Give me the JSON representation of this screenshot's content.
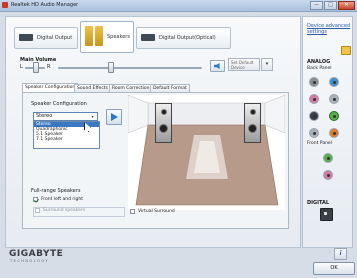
{
  "window": {
    "title": "Realtek HD Audio Manager",
    "minimize": "—",
    "maximize": "□",
    "close": "✕"
  },
  "device_tabs": [
    {
      "label": "Digital Output",
      "active": false
    },
    {
      "label": "Speakers",
      "active": true
    },
    {
      "label": "Digital Output(Optical)",
      "active": false
    }
  ],
  "main_volume": {
    "title": "Main Volume",
    "left": "L",
    "right": "R",
    "balance": 0.5,
    "level": 0.35,
    "set_default": "Set Default Device"
  },
  "sub_tabs": [
    "Speaker Configuration",
    "Sound Effects",
    "Room Correction",
    "Default Format"
  ],
  "speaker_config": {
    "label": "Speaker Configuration",
    "selected": "Stereo",
    "options": [
      "Stereo",
      "Quadraphonic",
      "5.1 Speaker",
      "7.1 Speaker"
    ],
    "highlighted_index": 0
  },
  "full_range": {
    "title": "Full-range Speakers",
    "front": "Front left and right",
    "front_checked": true,
    "surround": "Surround speakers",
    "surround_checked": false
  },
  "virtual_surround": {
    "label": "Virtual Surround",
    "checked": false
  },
  "right_panel": {
    "link": "Device advanced settings",
    "analog": "ANALOG",
    "back_panel": "Back Panel",
    "front_panel": "Front Panel",
    "digital": "DIGITAL",
    "back_jacks": [
      "#8a8f94",
      "#3d8fd1",
      "#d67aa0",
      "#a8b0b8",
      "#3a3f45",
      "#58b04a",
      "#a8b0b8",
      "#e07d2e"
    ],
    "front_jacks": [
      "#58b04a",
      "#d67aa0"
    ]
  },
  "footer": {
    "brand": "GIGABYTE",
    "brand_sub": "TECHNOLOGY",
    "info": "i",
    "ok": "OK"
  },
  "colors": {
    "accent": "#3a78c4",
    "link": "#2a5db0",
    "floor": "#b79a8a"
  }
}
